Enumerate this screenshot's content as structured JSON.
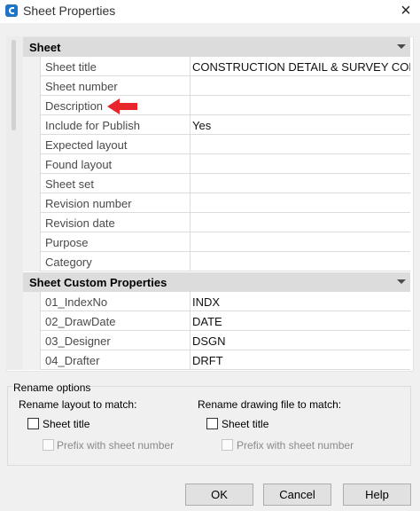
{
  "window": {
    "title": "Sheet Properties",
    "close_glyph": "×"
  },
  "sections": {
    "sheet": {
      "label": "Sheet",
      "rows": [
        {
          "name": "Sheet title",
          "value": "CONSTRUCTION DETAIL & SURVEY CON..."
        },
        {
          "name": "Sheet number",
          "value": ""
        },
        {
          "name": "Description",
          "value": ""
        },
        {
          "name": "Include for Publish",
          "value": "Yes"
        },
        {
          "name": "Expected layout",
          "value": ""
        },
        {
          "name": "Found layout",
          "value": ""
        },
        {
          "name": "Sheet set",
          "value": ""
        },
        {
          "name": "Revision number",
          "value": ""
        },
        {
          "name": "Revision date",
          "value": ""
        },
        {
          "name": "Purpose",
          "value": ""
        },
        {
          "name": "Category",
          "value": ""
        }
      ]
    },
    "custom": {
      "label": "Sheet Custom Properties",
      "rows": [
        {
          "name": "01_IndexNo",
          "value": "INDX"
        },
        {
          "name": "02_DrawDate",
          "value": "DATE"
        },
        {
          "name": "03_Designer",
          "value": "DSGN"
        },
        {
          "name": "04_Drafter",
          "value": "DRFT"
        }
      ]
    }
  },
  "rename": {
    "title": "Rename options",
    "layout": {
      "label": "Rename layout to match:",
      "sheet_title": "Sheet title",
      "prefix": "Prefix with sheet number",
      "sheet_title_checked": false,
      "prefix_checked": false
    },
    "drawing": {
      "label": "Rename drawing file to match:",
      "sheet_title": "Sheet title",
      "prefix": "Prefix with sheet number",
      "sheet_title_checked": false,
      "prefix_checked": false
    }
  },
  "buttons": {
    "ok": "OK",
    "cancel": "Cancel",
    "help": "Help"
  },
  "colors": {
    "annotation_arrow": "#e8262b",
    "app_icon": "#1f74c4"
  },
  "icons": {
    "app": "autocad-icon",
    "close": "close-icon",
    "collapse": "chevron-down-icon",
    "annotation": "red-arrow-icon"
  }
}
